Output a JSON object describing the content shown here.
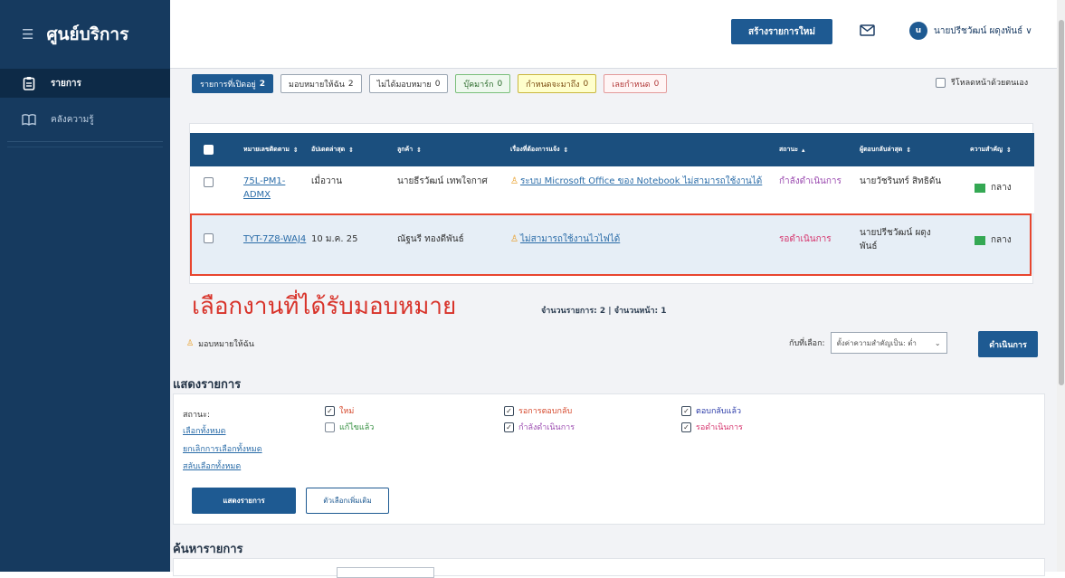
{
  "sidebar": {
    "title": "ศูนย์บริการ",
    "items": [
      {
        "label": "รายการ",
        "icon": "clipboard-icon"
      },
      {
        "label": "คลังความรู้",
        "icon": "book-icon"
      }
    ]
  },
  "topbar": {
    "create_label": "สร้างรายการใหม่",
    "avatar_initial": "u",
    "user_name": "นายปรีชวัฒน์ ผดุงพันธ์ ∨"
  },
  "filters": [
    {
      "label": "รายการที่เปิดอยู่",
      "count": "2"
    },
    {
      "label": "มอบหมายให้ฉัน",
      "count": "2"
    },
    {
      "label": "ไม่ได้มอบหมาย",
      "count": "0"
    },
    {
      "label": "บุ๊คมาร์ก",
      "count": "0"
    },
    {
      "label": "กำหนดจะมาถึง",
      "count": "0"
    },
    {
      "label": "เลยกำหนด",
      "count": "0"
    }
  ],
  "autorefresh_label": "รีโหลดหน้าด้วยตนเอง",
  "table": {
    "headers": [
      "หมายเลขติดตาม",
      "อัปเดตล่าสุด",
      "ลูกค้า",
      "เรื่องที่ต้องการแจ้ง",
      "สถานะ",
      "ผู้ตอบกลับล่าสุด",
      "ความสำคัญ"
    ],
    "rows": [
      {
        "id": "75L-PM1-ADMX",
        "updated": "เมื่อวาน",
        "customer": "นายธีรวัฒน์ เทพใจกาศ",
        "subject": "ระบบ Microsoft Office ของ Notebook ไม่สามารถใช้งานได้",
        "status": "กำลังดำเนินการ",
        "last_reply": "นายวัชรินทร์ สิทธิดัน",
        "priority": "กลาง"
      },
      {
        "id": "TYT-7Z8-WAJ4",
        "updated": "10 ม.ค. 25",
        "customer": "ณัฐนรี ทองดีพันธ์",
        "subject": "ไม่สามารถใช้งานไวไฟได้",
        "status": "รอดำเนินการ",
        "last_reply": "นายปรีชวัฒน์ ผดุงพันธ์",
        "priority": "กลาง"
      }
    ]
  },
  "annotation": "เลือกงานที่ได้รับมอบหมาย",
  "count_text": "จำนวนรายการ: 2 | จำนวนหน้า: 1",
  "assigned_label": "มอบหมายให้ฉัน",
  "with_selected_label": "กับที่เลือก:",
  "with_selected_value": "ตั้งค่าความสำคัญเป็น: ต่ำ",
  "action_label": "ดำเนินการ",
  "show_section": {
    "title": "แสดงรายการ",
    "status_label": "สถานะ:",
    "links": [
      "เลือกทั้งหมด",
      "ยกเลิกการเลือกทั้งหมด",
      "สลับเลือกทั้งหมด"
    ],
    "options": [
      {
        "label": "ใหม่",
        "checked": true,
        "color": "#d64a2e"
      },
      {
        "label": "แก้ไขแล้ว",
        "checked": false,
        "color": "#2e8b3a"
      },
      {
        "label": "รอการตอบกลับ",
        "checked": true,
        "color": "#d64a2e"
      },
      {
        "label": "กำลังดำเนินการ",
        "checked": true,
        "color": "#9b4bb0"
      },
      {
        "label": "ตอบกลับแล้ว",
        "checked": true,
        "color": "#2a3aa8"
      },
      {
        "label": "รอดำเนินการ",
        "checked": true,
        "color": "#d6336c"
      }
    ],
    "show_button": "แสดงรายการ",
    "more_options": "ตัวเลือกเพิ่มเติม"
  },
  "search_section": {
    "title": "ค้นหารายการ"
  },
  "colors": {
    "sidebar": "#163a5f",
    "accent": "#1e5a92",
    "header": "#1b4f7e",
    "highlight": "#e8452e"
  }
}
